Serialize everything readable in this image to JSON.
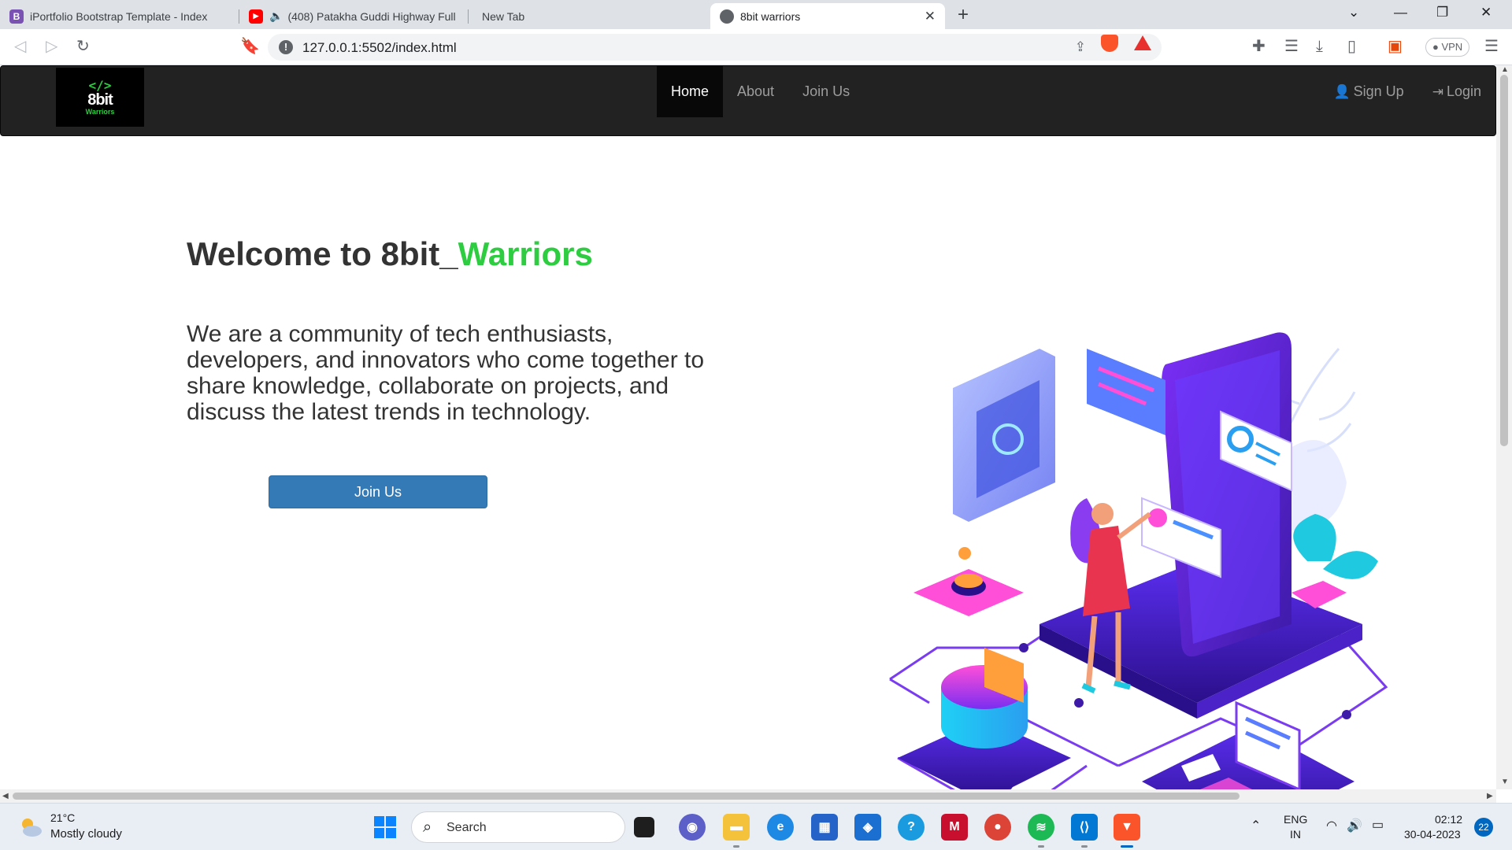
{
  "browser": {
    "tabs": [
      {
        "title": "iPortfolio Bootstrap Template - Index",
        "icon": "bootstrap-icon"
      },
      {
        "title": "(408) Patakha Guddi Highway Full",
        "icon": "youtube-icon",
        "audio": true
      },
      {
        "title": "New Tab",
        "icon": ""
      },
      {
        "title": "8bit warriors",
        "icon": "globe-icon",
        "active": true
      }
    ],
    "url": "127.0.0.1:5502/index.html",
    "vpn_label": "VPN"
  },
  "site": {
    "logo": {
      "brackets": "</>",
      "name": "8bit",
      "sub": "Warriors"
    },
    "nav": {
      "home": "Home",
      "about": "About",
      "join": "Join Us",
      "signup": "Sign Up",
      "login": "Login"
    },
    "hero": {
      "title_prefix": "Welcome to 8bit_",
      "title_accent": "Warriors",
      "description": "We are a community of tech enthusiasts, developers, and innovators who come together to share knowledge, collaborate on projects, and discuss the latest trends in technology.",
      "button": "Join Us"
    },
    "colors": {
      "accent": "#2ecc40",
      "navbar": "#222222",
      "button": "#337ab7"
    }
  },
  "taskbar": {
    "weather": {
      "temp": "21°C",
      "desc": "Mostly cloudy"
    },
    "search_label": "Search",
    "lang": {
      "line1": "ENG",
      "line2": "IN"
    },
    "clock": {
      "time": "02:12",
      "date": "30-04-2023"
    },
    "notifications": "22"
  }
}
